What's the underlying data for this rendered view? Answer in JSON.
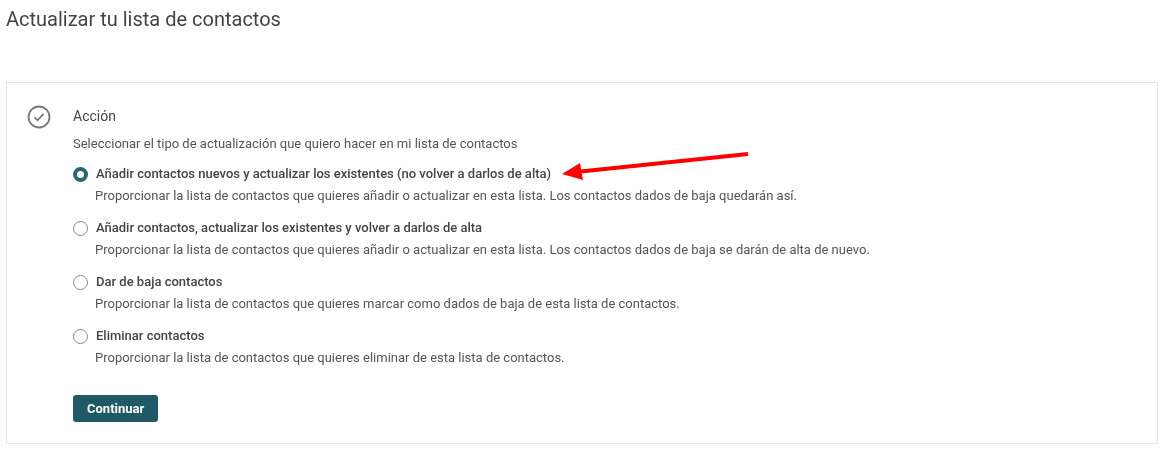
{
  "page_title": "Actualizar tu lista de contactos",
  "section": {
    "title": "Acción",
    "completed": true,
    "instruction": "Seleccionar el tipo de actualización que quiero hacer en mi lista de contactos",
    "options": [
      {
        "label": "Añadir contactos nuevos y actualizar los existentes (no volver a darlos de alta)",
        "description": "Proporcionar la lista de contactos que quieres añadir o actualizar en esta lista. Los contactos dados de baja quedarán así.",
        "selected": true
      },
      {
        "label": "Añadir contactos, actualizar los existentes y volver a darlos de alta",
        "description": "Proporcionar la lista de contactos que quieres añadir o actualizar en esta lista. Los contactos dados de baja se darán de alta de nuevo.",
        "selected": false
      },
      {
        "label": "Dar de baja contactos",
        "description": "Proporcionar la lista de contactos que quieres marcar como dados de baja de esta lista de contactos.",
        "selected": false
      },
      {
        "label": "Eliminar contactos",
        "description": "Proporcionar la lista de contactos que quieres eliminar de esta lista de contactos.",
        "selected": false
      }
    ],
    "button": "Continuar"
  }
}
